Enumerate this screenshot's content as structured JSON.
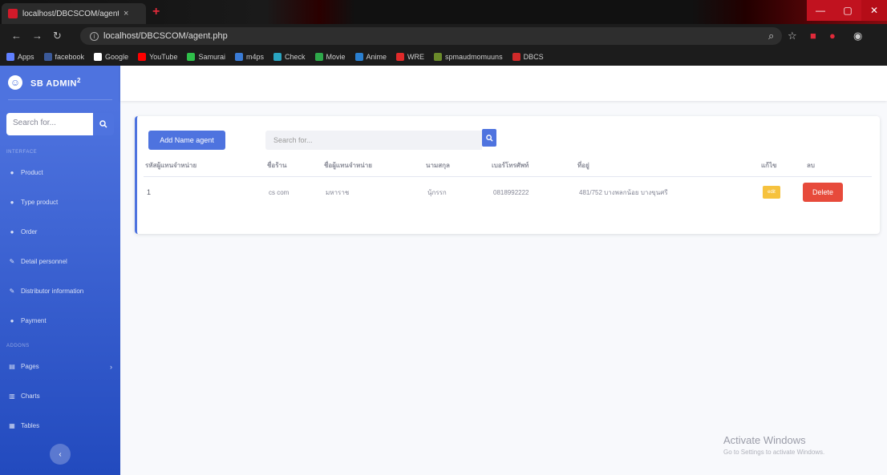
{
  "browser": {
    "tab_title": "localhost/DBCSCOM/agent.php",
    "tab_close": "×",
    "new_tab": "+",
    "url": "localhost/DBCSCOM/agent.php",
    "window_controls": {
      "minimize": "—",
      "maximize": "▢",
      "close": "✕"
    },
    "nav": {
      "back": "←",
      "forward": "→",
      "reload": "↻"
    },
    "bookmarks": [
      {
        "label": "Apps",
        "color": "#5f7fff"
      },
      {
        "label": "facebook",
        "color": "#3b5998"
      },
      {
        "label": "Google",
        "color": "#ffffff"
      },
      {
        "label": "YouTube",
        "color": "#ff0000"
      },
      {
        "label": "Samurai",
        "color": "#2fbf4a"
      },
      {
        "label": "m4ps",
        "color": "#3a7bd5"
      },
      {
        "label": "Check",
        "color": "#2aa4c0"
      },
      {
        "label": "Movie",
        "color": "#2ea84a"
      },
      {
        "label": "Anime",
        "color": "#2a7fd0"
      },
      {
        "label": "WRE",
        "color": "#e02a2a"
      },
      {
        "label": "spmaudmomuuns",
        "color": "#6a8a2a"
      },
      {
        "label": "DBCS",
        "color": "#d02a2a"
      }
    ]
  },
  "sidebar": {
    "brand": "SB ADMIN",
    "brand_sup": "2",
    "search_placeholder": "Search for...",
    "heading_interface": "INTERFACE",
    "heading_addons": "ADDONS",
    "items": [
      {
        "label": "Product",
        "icon": "●"
      },
      {
        "label": "Type product",
        "icon": "●"
      },
      {
        "label": "Order",
        "icon": "●"
      },
      {
        "label": "Detail personnel",
        "icon": "✎"
      },
      {
        "label": "Distributor information",
        "icon": "✎"
      },
      {
        "label": "Payment",
        "icon": "●"
      }
    ],
    "addons": [
      {
        "label": "Pages",
        "icon": "▤",
        "chevron": "›"
      },
      {
        "label": "Charts",
        "icon": "▥"
      },
      {
        "label": "Tables",
        "icon": "▦"
      }
    ],
    "toggle": "‹"
  },
  "content": {
    "add_button": "Add Name agent",
    "search_placeholder": "Search for...",
    "columns": [
      "รหัสผู้แทนจำหน่าย",
      "ชื่อร้าน",
      "ชื่อผู้แทนจำหน่าย",
      "นามสกุล",
      "เบอร์โทรศัพท์",
      "ที่อยู่",
      "แก้ไข",
      "ลบ"
    ],
    "rows": [
      {
        "id": "1",
        "shop": "cs com",
        "name": "มหาราช",
        "surname": "นุ้กรรก",
        "phone": "0818992222",
        "address": "481/752 บางพลกน้อย บางขุนศรี",
        "edit": "edit",
        "delete": "Delete"
      }
    ]
  },
  "watermark": {
    "title": "Activate Windows",
    "subtitle": "Go to Settings to activate Windows."
  }
}
